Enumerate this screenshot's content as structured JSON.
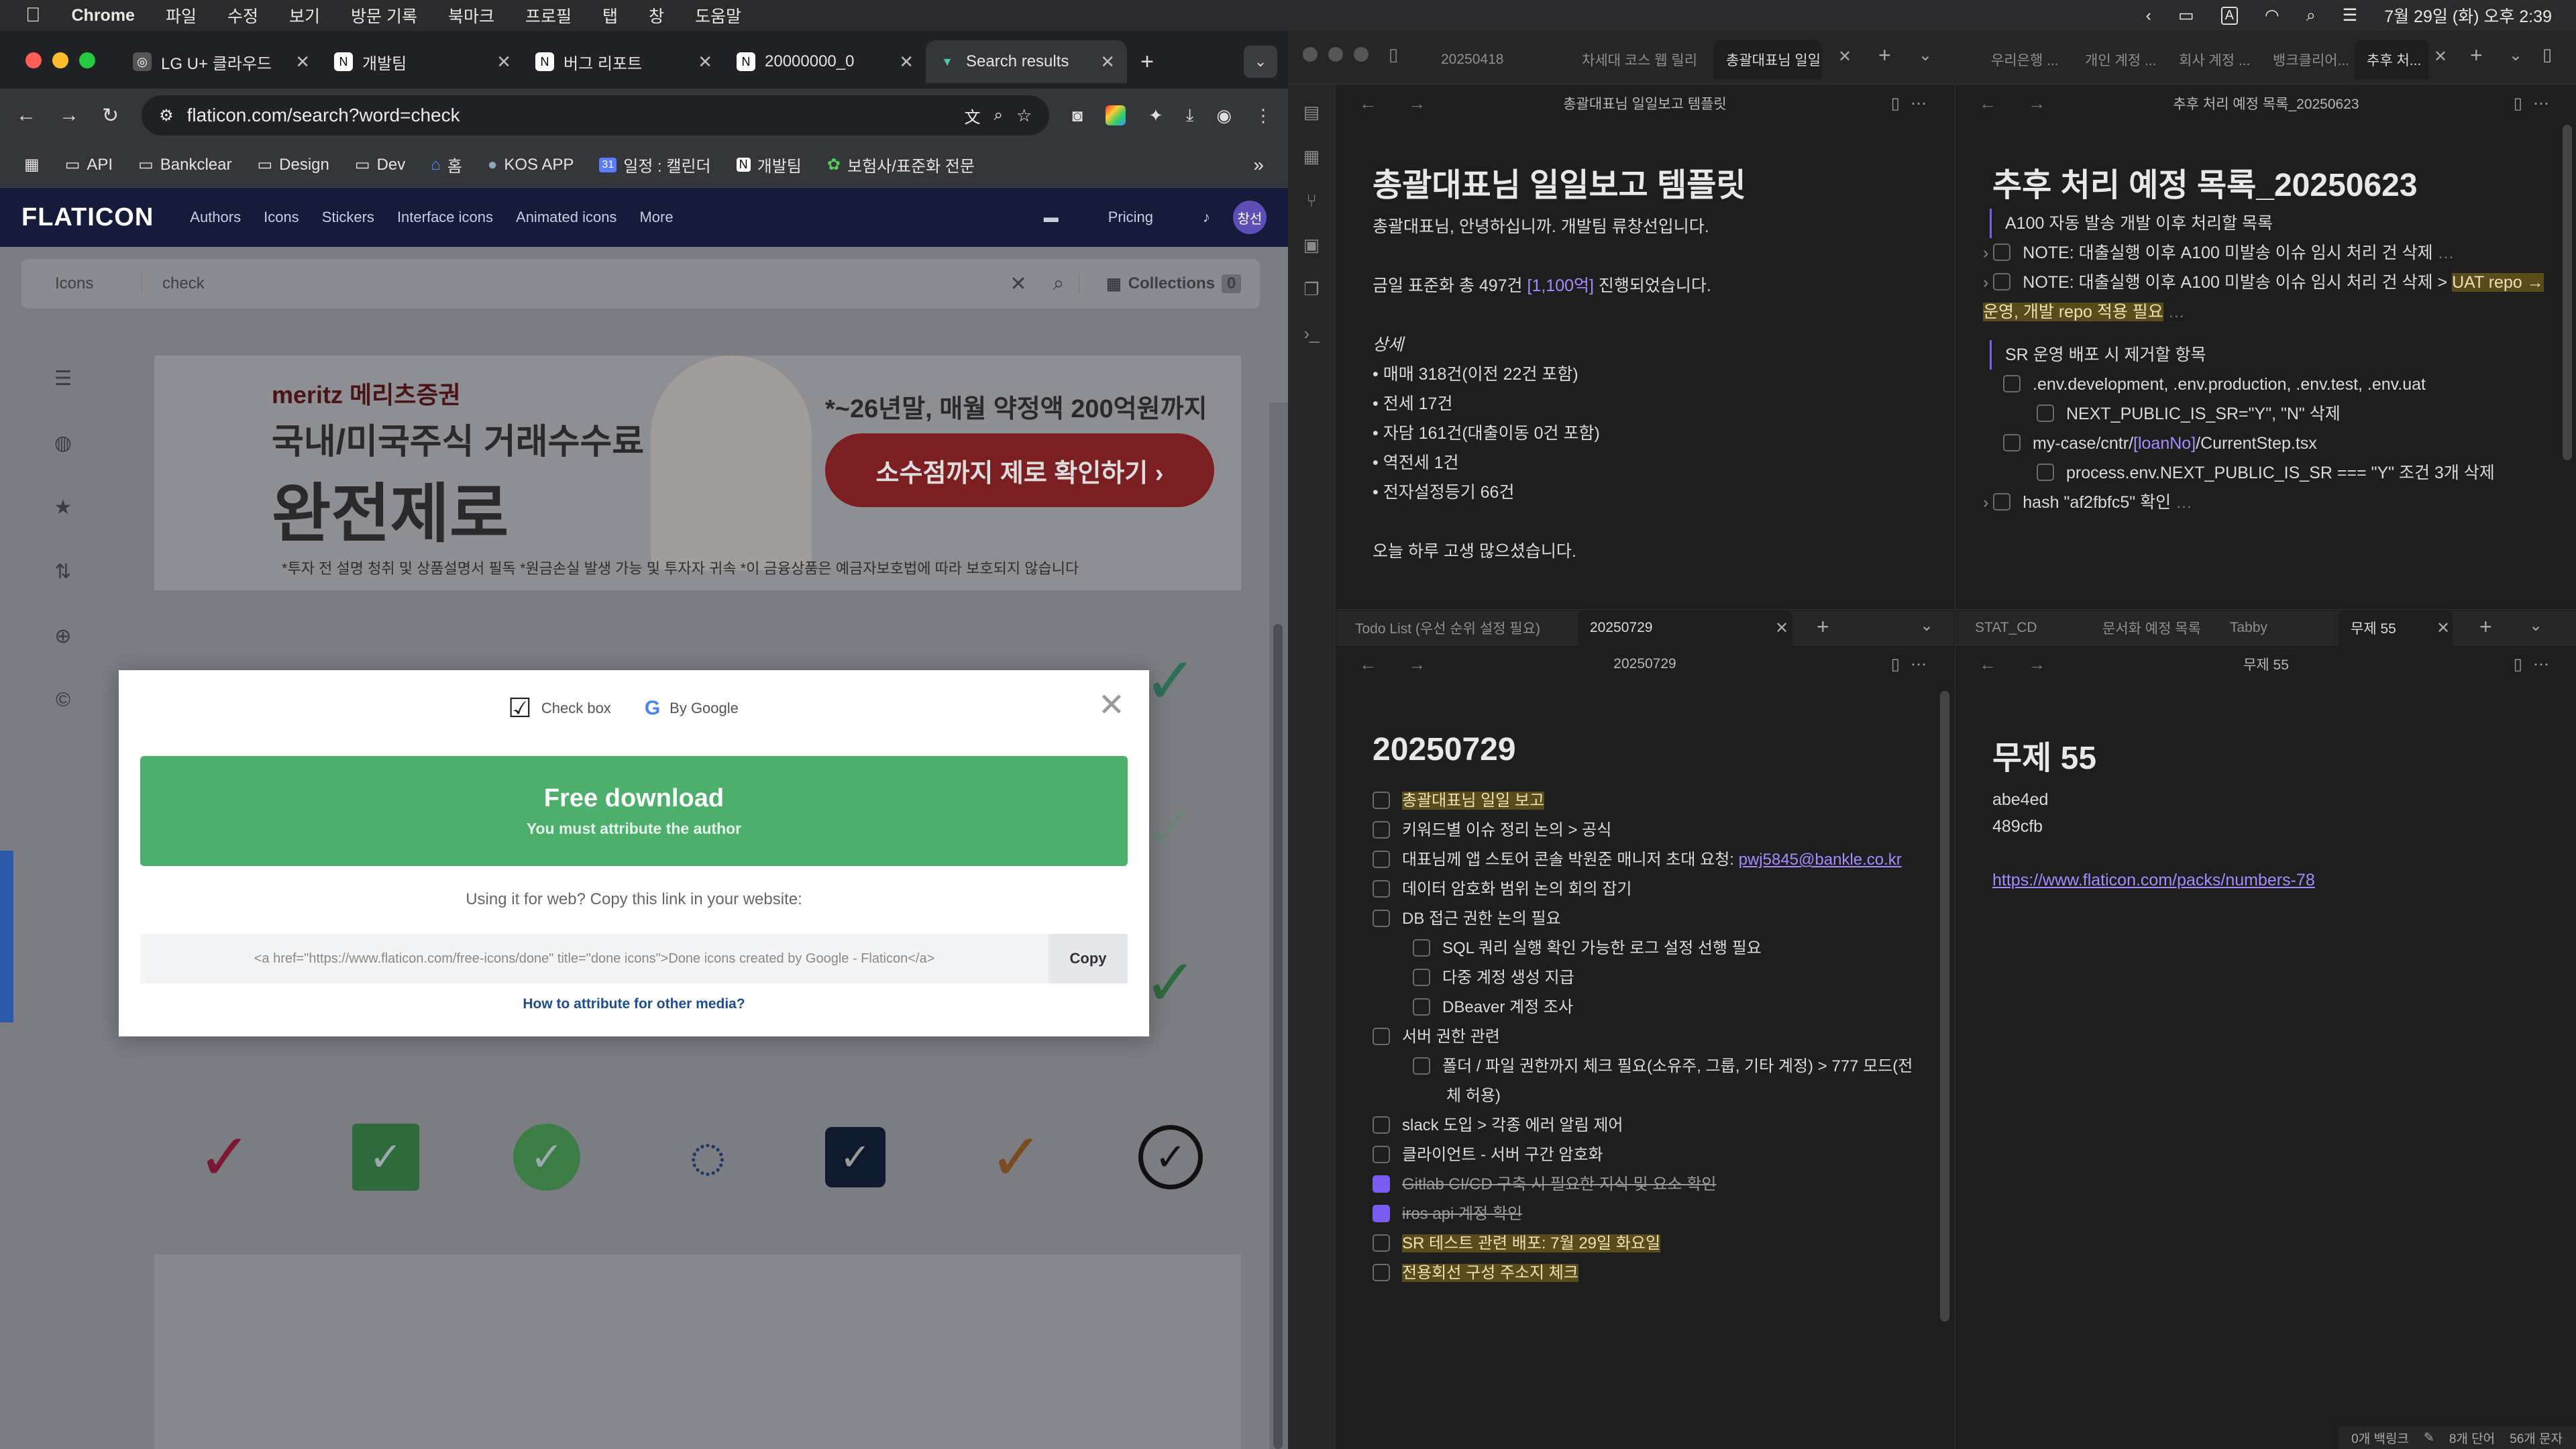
{
  "menubar": {
    "app": "Chrome",
    "items": [
      "파일",
      "수정",
      "보기",
      "방문 기록",
      "북마크",
      "프로필",
      "탭",
      "창",
      "도움말"
    ],
    "datetime": "7월 29일 (화) 오후 2:39"
  },
  "chrome": {
    "tabs": [
      {
        "label": "LG U+ 클라우드"
      },
      {
        "label": "개발팀"
      },
      {
        "label": "버그 리포트"
      },
      {
        "label": "20000000_0"
      },
      {
        "label": "Search results"
      }
    ],
    "url": "flaticon.com/search?word=check",
    "bookmarks": [
      "API",
      "Bankclear",
      "Design",
      "Dev",
      "홈",
      "KOS APP",
      "일정 : 캘린더",
      "개발팀",
      "보험사/표준화 전문"
    ]
  },
  "flaticon": {
    "logo": "FLATICON",
    "nav": [
      "Authors",
      "Icons",
      "Stickers",
      "Interface icons",
      "Animated icons",
      "More"
    ],
    "pricing": "Pricing",
    "avatar": "창선",
    "search_type": "Icons",
    "search_value": "check",
    "collections_label": "Collections",
    "collections_count": "0",
    "ad": {
      "brand": "meritz 메리츠증권",
      "line1": "국내/미국주식 거래수수료",
      "line2": "완전제로",
      "line3": "*~26년말, 매월 약정액 200억원까지",
      "button": "소수점까지 제로 확인하기 ›",
      "disclaimer": "*투자 전 설명 청취 및 상품설명서 필독 *원금손실 발생 가능 및 투자자 귀속 *이 금융상품은 예금자보호법에 따라 보호되지 않습니다"
    },
    "modal": {
      "tab1": "Check box",
      "tab2": "By Google",
      "download_title": "Free download",
      "download_sub": "You must attribute the author",
      "web_question": "Using it for web? Copy this link in your website:",
      "code": "<a href=\"https://www.flaticon.com/free-icons/done\" title=\"done icons\">Done icons created by Google - Flaticon</a>",
      "copy": "Copy",
      "howto": "How to attribute for other media?"
    }
  },
  "obsidian": {
    "left_tabs": [
      "20250418",
      "차세대 코스 웹 릴리...",
      "총괄대표님 일일..."
    ],
    "right_tabs": [
      "우리은행 ...",
      "개인 계정 ...",
      "회사 계정 ...",
      "뱅크클리어...",
      "추후 처..."
    ],
    "bottom_left_tabs": [
      "Todo List (우선 순위 설정 필요)",
      "20250729"
    ],
    "bottom_right_tabs": [
      "STAT_CD",
      "문서화 예정 목록",
      "Tabby",
      "무제 55"
    ],
    "note1": {
      "header": "총괄대표님 일일보고 템플릿",
      "title": "총괄대표님 일일보고 템플릿",
      "greet": "총괄대표님, 안녕하십니까. 개발팀 류창선입니다.",
      "summary_pre": "금일 표준화 총 497건 ",
      "summary_link": "[1,100억]",
      "summary_post": " 진행되었습니다.",
      "detail_label": "상세",
      "items": [
        "매매 318건(이전 22건 포함)",
        "전세 17건",
        "자담 161건(대출이동 0건 포함)",
        "역전세 1건",
        "전자설정등기 66건"
      ],
      "closing": "오늘 하루 고생 많으셨습니다."
    },
    "note2": {
      "header": "추후 처리 예정 목록_20250623",
      "title": "추후 처리 예정 목록_20250623",
      "s1": "A100 자동 발송 개발 이후 처리할 목록",
      "n1": "NOTE: 대출실행 이후 A100 미발송 이슈 임시 처리 건 삭제",
      "n2a": "NOTE: 대출실행 이후 A100 미발송 이슈 임시 처리 건 삭제 > ",
      "n2b": "UAT repo → 운영, 개발 repo 적용 필요",
      "s2": "SR 운영 배포 시 제거할 항목",
      "e1": ".env.development, .env.production, .env.test, .env.uat",
      "e2": "NEXT_PUBLIC_IS_SR=\"Y\", \"N\" 삭제",
      "e3a": "my-case/cntr/",
      "e3b": "[loanNo]",
      "e3c": "/CurrentStep.tsx",
      "e4": "process.env.NEXT_PUBLIC_IS_SR === \"Y\" 조건 3개 삭제",
      "e5": "hash \"af2fbfc5\" 확인"
    },
    "note3": {
      "header": "20250729",
      "title": "20250729",
      "t1": "총괄대표님 일일 보고",
      "t2": "키워드별 이슈 정리 논의 > 공식",
      "t3": "대표님께 앱 스토어 콘솔 박원준 매니저 초대 요청: ",
      "t3link": "pwj5845@bankle.co.kr",
      "t4": "데이터 암호화 범위 논의 회의 잡기",
      "t5": "DB 접근 권한 논의 필요",
      "t5a": "SQL 쿼리 실행 확인 가능한 로그 설정 선행 필요",
      "t5b": "다중 계정 생성 지급",
      "t5c": "DBeaver 계정 조사",
      "t6": "서버 권한 관련",
      "t6a": "폴더 / 파일 권한까지 체크 필요(소유주, 그룹, 기타 계정) > 777 모드(전체 허용)",
      "t7": "slack 도입 > 각종 에러 알림 제어",
      "t8": "클라이언트 - 서버 구간 암호화",
      "t9": "Gitlab CI/CD 구축 시 필요한 지식 및 요소 확인",
      "t10": "iros api 계정 확인",
      "t11": "SR 테스트 관련 배포: 7월 29일 화요일",
      "t12": "전용회선 구성 주소지 체크"
    },
    "note4": {
      "header": "무제 55",
      "title": "무제 55",
      "l1": "abe4ed",
      "l2": "489cfb",
      "link": "https://www.flaticon.com/packs/numbers-78"
    },
    "status": {
      "backlinks": "0개 백링크",
      "words": "8개 단어",
      "chars": "56개 문자"
    }
  }
}
